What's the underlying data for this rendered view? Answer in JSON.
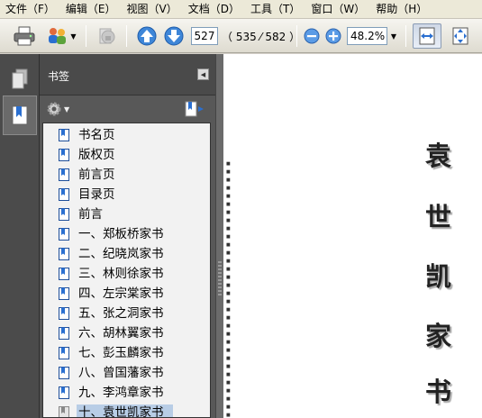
{
  "menubar": {
    "items": [
      "文件（F）",
      "编辑（E）",
      "视图（V）",
      "文档（D）",
      "工具（T）",
      "窗口（W）",
      "帮助（H）"
    ]
  },
  "toolbar": {
    "current_page": "527",
    "page_count": "（ 535 ⁄ 582 ）",
    "zoom": "48.2%"
  },
  "bookmarks": {
    "title": "书签",
    "items": [
      {
        "label": "书名页"
      },
      {
        "label": "版权页"
      },
      {
        "label": "前言页"
      },
      {
        "label": "目录页"
      },
      {
        "label": "前言"
      },
      {
        "label": "一、郑板桥家书"
      },
      {
        "label": "二、纪晓岚家书"
      },
      {
        "label": "三、林则徐家书"
      },
      {
        "label": "四、左宗棠家书"
      },
      {
        "label": "五、张之洞家书"
      },
      {
        "label": "六、胡林翼家书"
      },
      {
        "label": "七、彭玉麟家书"
      },
      {
        "label": "八、曾国藩家书"
      },
      {
        "label": "九、李鸿章家书"
      },
      {
        "label": "十、袁世凯家书"
      }
    ],
    "selected_index": 14
  },
  "document": {
    "title_chars": [
      "袁",
      "世",
      "凯",
      "家",
      "书"
    ]
  },
  "colors": {
    "panel_dark": "#4b4b4b",
    "selection": "#b8cde6",
    "accent_blue": "#2a6fd0"
  }
}
